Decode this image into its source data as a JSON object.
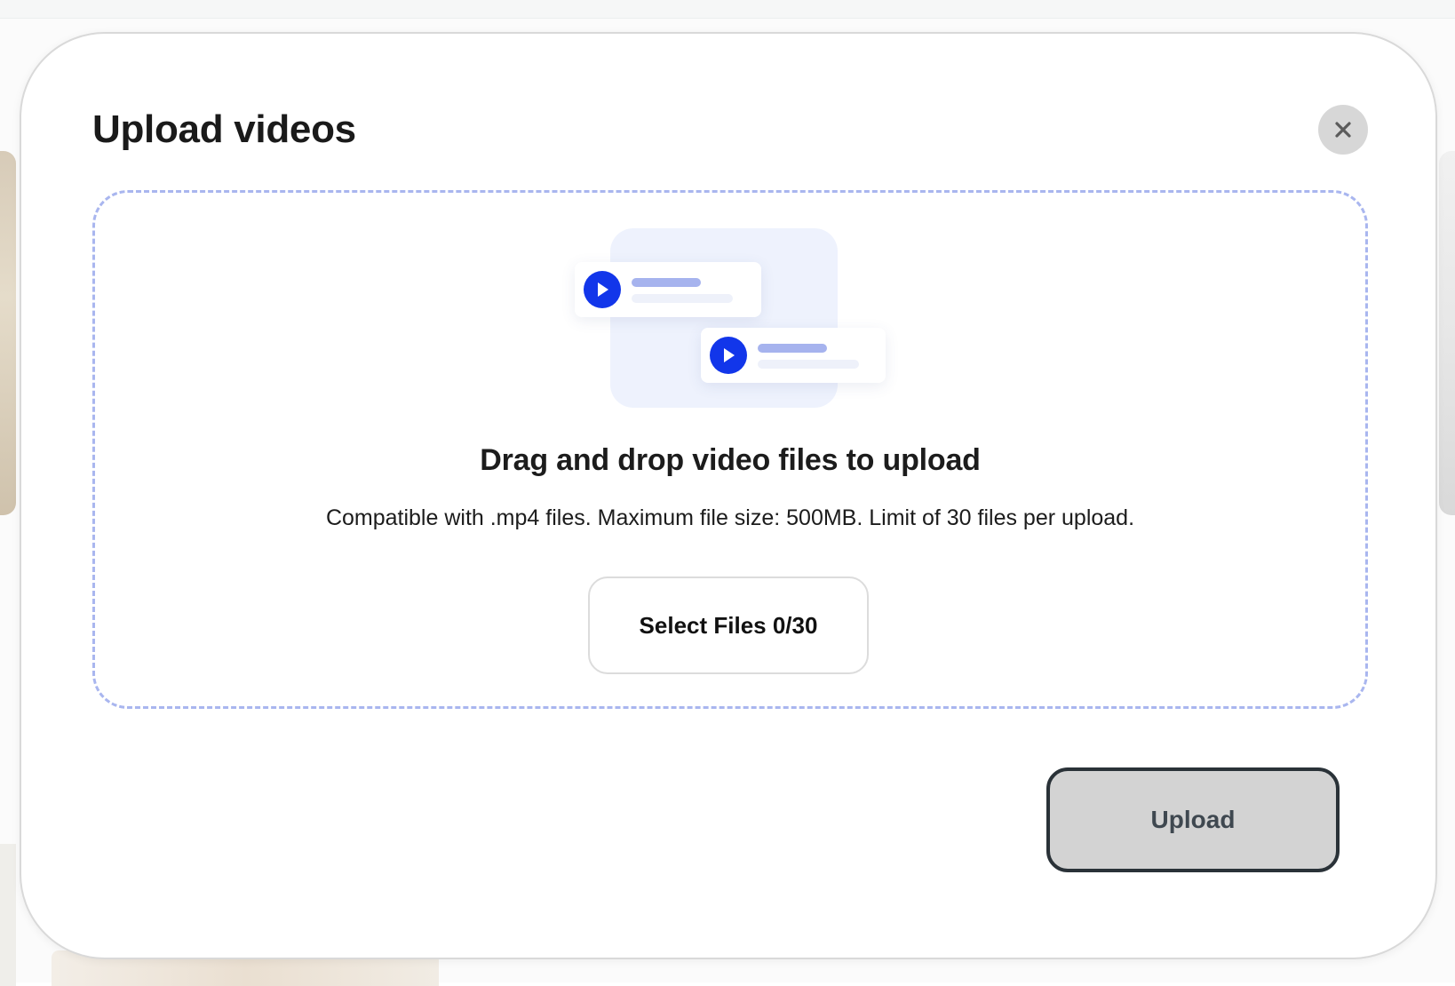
{
  "modal": {
    "title": "Upload videos",
    "close_icon": "close-icon"
  },
  "drop_zone": {
    "heading": "Drag and drop video files to upload",
    "subtext": "Compatible with .mp4 files. Maximum file size: 500MB. Limit of 30 files per upload.",
    "select_button_label": "Select Files 0/30",
    "illustration_icons": [
      "play-icon",
      "play-icon"
    ]
  },
  "footer": {
    "upload_label": "Upload"
  },
  "colors": {
    "accent_blue": "#1236ea",
    "dashed_border": "#a9b6ef",
    "placeholder_line": "#a6b3ee",
    "upload_disabled_bg": "#d3d3d3",
    "upload_border": "#2a3238"
  }
}
